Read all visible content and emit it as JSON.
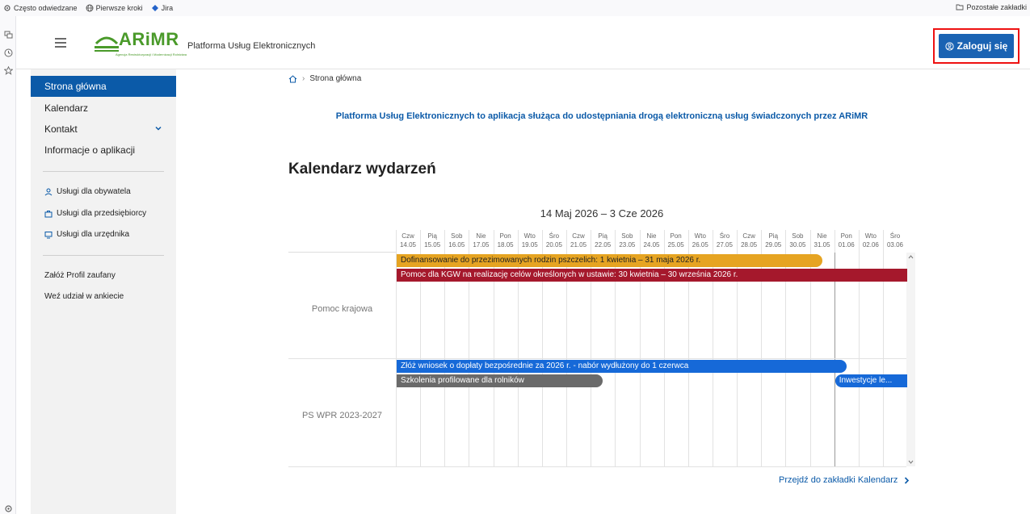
{
  "browser": {
    "bookmarks": [
      {
        "label": "Często odwiedzane",
        "icon": "gear-icon"
      },
      {
        "label": "Pierwsze kroki",
        "icon": "globe-icon"
      },
      {
        "label": "Jira",
        "icon": "jira-icon"
      }
    ],
    "other_bookmarks": "Pozostałe zakładki"
  },
  "header": {
    "logo_text": "ARiMR",
    "logo_subtitle": "Agencja Restrukturyzacji i Modernizacji Rolnictwa",
    "app_title": "Platforma Usług Elektronicznych",
    "login_label": "Zaloguj się"
  },
  "nav": {
    "items": [
      {
        "label": "Strona główna",
        "active": true
      },
      {
        "label": "Kalendarz"
      },
      {
        "label": "Kontakt"
      },
      {
        "label": "Informacje o aplikacji"
      }
    ],
    "services": [
      {
        "label": "Usługi dla obywatela",
        "icon": "person-icon"
      },
      {
        "label": "Usługi dla przedsiębiorcy",
        "icon": "briefcase-icon"
      },
      {
        "label": "Usługi dla urzędnika",
        "icon": "monitor-icon"
      }
    ],
    "extra": [
      {
        "label": "Załóż Profil zaufany"
      },
      {
        "label": "Weź udział w ankiecie"
      }
    ]
  },
  "main": {
    "breadcrumb": "Strona główna",
    "intro": "Platforma Usług Elektronicznych to aplikacja służąca do udostępniania drogą elektroniczną usług świadczonych przez ARiMR",
    "section_title": "Kalendarz wydarzeń",
    "range_title": "14 Maj 2026 – 3 Cze 2026",
    "goto_label": "Przejdź do zakładki Kalendarz"
  },
  "calendar": {
    "days": [
      {
        "dow": "Czw",
        "date": "14.05"
      },
      {
        "dow": "Pią",
        "date": "15.05"
      },
      {
        "dow": "Sob",
        "date": "16.05"
      },
      {
        "dow": "Nie",
        "date": "17.05"
      },
      {
        "dow": "Pon",
        "date": "18.05"
      },
      {
        "dow": "Wto",
        "date": "19.05"
      },
      {
        "dow": "Śro",
        "date": "20.05"
      },
      {
        "dow": "Czw",
        "date": "21.05"
      },
      {
        "dow": "Pią",
        "date": "22.05"
      },
      {
        "dow": "Sob",
        "date": "23.05"
      },
      {
        "dow": "Nie",
        "date": "24.05"
      },
      {
        "dow": "Pon",
        "date": "25.05"
      },
      {
        "dow": "Wto",
        "date": "26.05"
      },
      {
        "dow": "Śro",
        "date": "27.05"
      },
      {
        "dow": "Czw",
        "date": "28.05"
      },
      {
        "dow": "Pią",
        "date": "29.05"
      },
      {
        "dow": "Sob",
        "date": "30.05"
      },
      {
        "dow": "Nie",
        "date": "31.05"
      },
      {
        "dow": "Pon",
        "date": "01.06"
      },
      {
        "dow": "Wto",
        "date": "02.06"
      },
      {
        "dow": "Śro",
        "date": "03.06"
      }
    ],
    "today_date": "01.06",
    "groups": [
      {
        "label": "Pomoc krajowa"
      },
      {
        "label": "PS WPR 2023-2027"
      }
    ],
    "events": [
      {
        "group": 0,
        "label": "Dofinansowanie do przezimowanych rodzin pszczelich: 1 kwietnia – 31 maja 2026 r.",
        "start": "14.05",
        "end": "31.05",
        "color": "#e6a422"
      },
      {
        "group": 0,
        "label": "Pomoc dla KGW na realizację celów określonych w ustawie: 30 kwietnia – 30 września 2026 r.",
        "start": "14.05",
        "end": "03.06",
        "color": "#a5182c"
      },
      {
        "group": 1,
        "label": "Złóż wniosek o dopłaty bezpośrednie za 2026 r. - nabór wydłużony do 1 czerwca",
        "start": "14.05",
        "end": "01.06",
        "color": "#1669d8"
      },
      {
        "group": 1,
        "label": "Szkolenia profilowane dla rolników",
        "start": "14.05",
        "end": "22.05",
        "color": "#6a6a6a"
      },
      {
        "group": 1,
        "label": "Inwestycje le...",
        "start": "01.06",
        "end": "03.06",
        "color": "#1669d8"
      }
    ]
  },
  "colors": {
    "primary": "#0b5aa8",
    "login_button": "#1a63b3",
    "highlight_frame": "#e11111",
    "brand_green": "#4a9a2a"
  }
}
